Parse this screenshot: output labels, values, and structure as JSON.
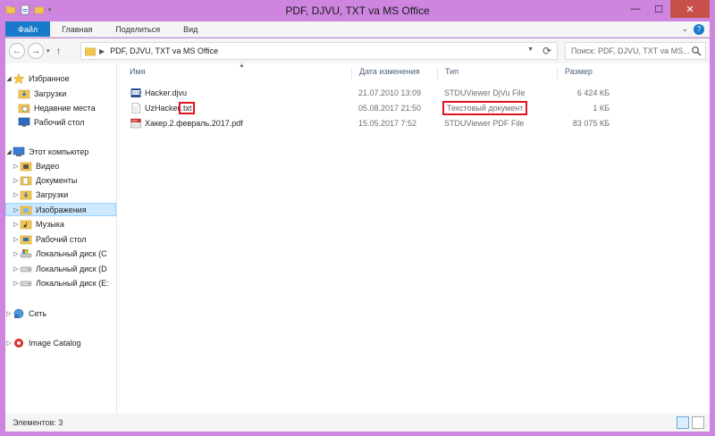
{
  "window": {
    "title": "PDF, DJVU, TXT va MS Office",
    "minimize": "—",
    "maximize": "☐",
    "close": "✕"
  },
  "ribbon": {
    "tabs": [
      {
        "label": "Файл"
      },
      {
        "label": "Главная"
      },
      {
        "label": "Поделиться"
      },
      {
        "label": "Вид"
      }
    ],
    "help": "?",
    "expand": "⌄"
  },
  "address": {
    "path": "PDF, DJVU, TXT va MS Office",
    "search_placeholder": "Поиск: PDF, DJVU, TXT va MS..."
  },
  "nav": {
    "favorites": "Избранное",
    "fav_items": [
      "Загрузки",
      "Недавние места",
      "Рабочий стол"
    ],
    "computer": "Этот компьютер",
    "computer_items": [
      "Видео",
      "Документы",
      "Загрузки",
      "Изображения",
      "Музыка",
      "Рабочий стол",
      "Локальный диск (C",
      "Локальный диск (D",
      "Локальный диск (E:"
    ],
    "network": "Сеть",
    "catalog": "Image Catalog"
  },
  "columns": {
    "name": "Имя",
    "date": "Дата изменения",
    "type": "Тип",
    "size": "Размер"
  },
  "files": [
    {
      "name": "Hacker.djvu",
      "date": "21.07.2010 13:09",
      "type": "STDUViewer DjVu File",
      "size": "6 424 КБ"
    },
    {
      "name_base": "UzHacker",
      "name_ext": ".txt",
      "date": "05.08.2017 21:50",
      "type": "Текстовый документ",
      "size": "1 КБ"
    },
    {
      "name": "Хакер.2.февраль.2017.pdf",
      "date": "15.05.2017 7:52",
      "type": "STDUViewer PDF File",
      "size": "83 075 КБ"
    }
  ],
  "status": {
    "count": "Элементов: 3"
  },
  "colors": {
    "accent": "#1979ca",
    "highlight": "#e0141e",
    "selection": "#cce8ff"
  }
}
